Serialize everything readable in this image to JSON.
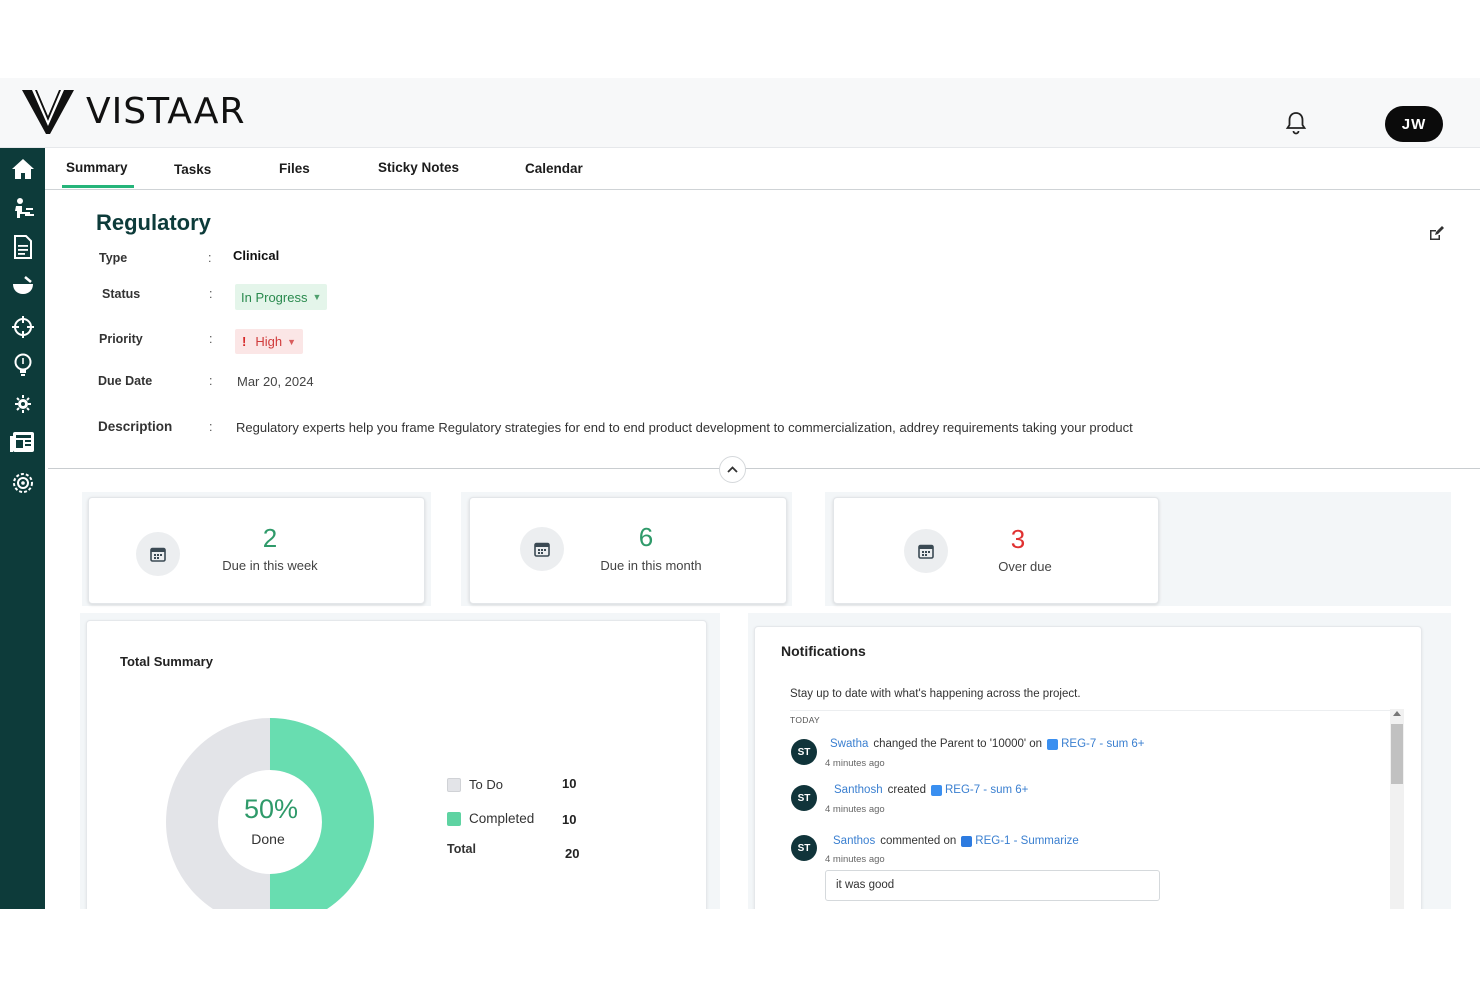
{
  "app": {
    "brand": "VISTAAR",
    "user_initials": "JW"
  },
  "colors": {
    "sidebar": "#0d3b3a",
    "accent": "#26b47a",
    "overdue": "#e03131",
    "due": "#2f9a6a",
    "donut_done": "#68ddb0",
    "donut_todo": "#e3e4e8"
  },
  "sidebar": {
    "items": [
      {
        "icon": "home-icon"
      },
      {
        "icon": "person-desk-icon"
      },
      {
        "icon": "document-icon"
      },
      {
        "icon": "bowl-icon"
      },
      {
        "icon": "crosshair-icon"
      },
      {
        "icon": "bulb-icon"
      },
      {
        "icon": "gear-plant-icon"
      },
      {
        "icon": "newspaper-icon"
      },
      {
        "icon": "settings-icon"
      }
    ]
  },
  "tabs": [
    {
      "label": "Summary",
      "active": true
    },
    {
      "label": "Tasks"
    },
    {
      "label": "Files"
    },
    {
      "label": "Sticky Notes"
    },
    {
      "label": "Calendar"
    }
  ],
  "project": {
    "title": "Regulatory",
    "fields": {
      "type_label": "Type",
      "type_value": "Clinical",
      "status_label": "Status",
      "status_value": "In Progress",
      "priority_label": "Priority",
      "priority_value": "High",
      "due_label": "Due Date",
      "due_value": "Mar 20, 2024",
      "desc_label": "Description",
      "desc_value": "Regulatory experts help you frame Regulatory strategies for end to end product development to commercialization, addrey requirements taking your product"
    },
    "colon": ":"
  },
  "stats": [
    {
      "value": "2",
      "label": "Due in this week"
    },
    {
      "value": "6",
      "label": "Due in this month"
    },
    {
      "value": "3",
      "label": "Over due"
    }
  ],
  "total_summary": {
    "title": "Total Summary",
    "percent_label": "50%",
    "done_label": "Done",
    "done_fraction": 0.5,
    "legend": [
      {
        "label": "To Do",
        "value": "10"
      },
      {
        "label": "Completed",
        "value": "10"
      },
      {
        "label": "Total",
        "value": "20"
      }
    ]
  },
  "notifications": {
    "title": "Notifications",
    "subtitle": "Stay up to date with what's happening across the project.",
    "group": "TODAY",
    "items": [
      {
        "initials": "ST",
        "user": "Swatha",
        "action": "changed the Parent to '10000' on",
        "link": "REG-7 - sum 6+",
        "time": "4 minutes ago"
      },
      {
        "initials": "ST",
        "user": "Santhosh",
        "action": "created",
        "link": "REG-7 - sum 6+",
        "time": "4 minutes ago"
      },
      {
        "initials": "ST",
        "user": "Santhos",
        "action": "commented on",
        "link": "REG-1 - Summarize",
        "time": "4 minutes ago",
        "comment": "it was good"
      }
    ]
  }
}
